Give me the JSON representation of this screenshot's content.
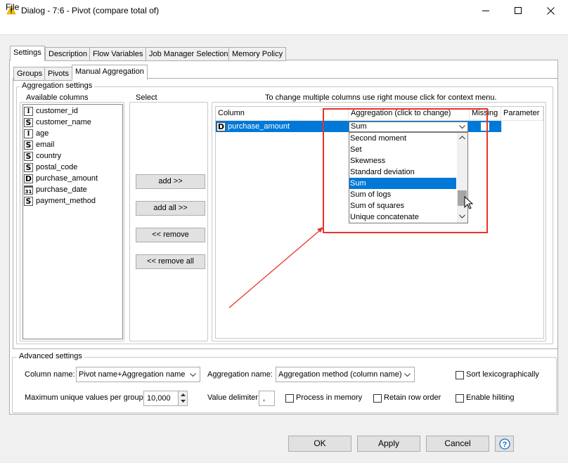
{
  "window": {
    "title": "Dialog - 7:6 - Pivot (compare total of)"
  },
  "menu": {
    "file": "File"
  },
  "tabs": [
    "Settings",
    "Description",
    "Flow Variables",
    "Job Manager Selection",
    "Memory Policy"
  ],
  "subtabs": [
    "Groups",
    "Pivots",
    "Manual Aggregation"
  ],
  "aggregation_settings": {
    "title": "Aggregation settings",
    "available_columns_label": "Available columns",
    "select_label": "Select",
    "hint": "To change multiple columns use right mouse click for context menu.",
    "columns": [
      {
        "type": "I",
        "name": "customer_id"
      },
      {
        "type": "S",
        "name": "customer_name"
      },
      {
        "type": "I",
        "name": "age"
      },
      {
        "type": "S",
        "name": "email"
      },
      {
        "type": "S",
        "name": "country"
      },
      {
        "type": "S",
        "name": "postal_code"
      },
      {
        "type": "D",
        "name": "purchase_amount"
      },
      {
        "type": "date",
        "name": "purchase_date"
      },
      {
        "type": "S",
        "name": "payment_method"
      }
    ],
    "buttons": {
      "add": "add >>",
      "add_all": "add all >>",
      "remove": "<< remove",
      "remove_all": "<< remove all"
    },
    "table_headers": {
      "column": "Column",
      "aggregation": "Aggregation (click to change)",
      "missing": "Missing",
      "parameter": "Parameter"
    },
    "row": {
      "type": "D",
      "column": "purchase_amount",
      "aggregation": "Sum"
    },
    "dropdown_options": [
      "Second moment",
      "Set",
      "Skewness",
      "Standard deviation",
      "Sum",
      "Sum of logs",
      "Sum of squares",
      "Unique concatenate"
    ],
    "dropdown_selected": "Sum",
    "date_badge": "31"
  },
  "advanced_settings": {
    "title": "Advanced settings",
    "column_name_label": "Column name:",
    "column_name_value": "Pivot name+Aggregation name",
    "aggregation_name_label": "Aggregation name:",
    "aggregation_name_value": "Aggregation method (column name)",
    "sort_label": "Sort lexicographically",
    "max_unique_label": "Maximum unique values per group",
    "max_unique_value": "10,000",
    "value_delimiter_label": "Value delimiter",
    "value_delimiter_value": ",",
    "process_in_memory_label": "Process in memory",
    "retain_row_order_label": "Retain row order",
    "enable_hiliting_label": "Enable hiliting"
  },
  "footer": {
    "ok": "OK",
    "apply": "Apply",
    "cancel": "Cancel",
    "help_icon": "help-icon"
  },
  "colors": {
    "accent": "#0078d7",
    "annotation": "#e8332a"
  }
}
